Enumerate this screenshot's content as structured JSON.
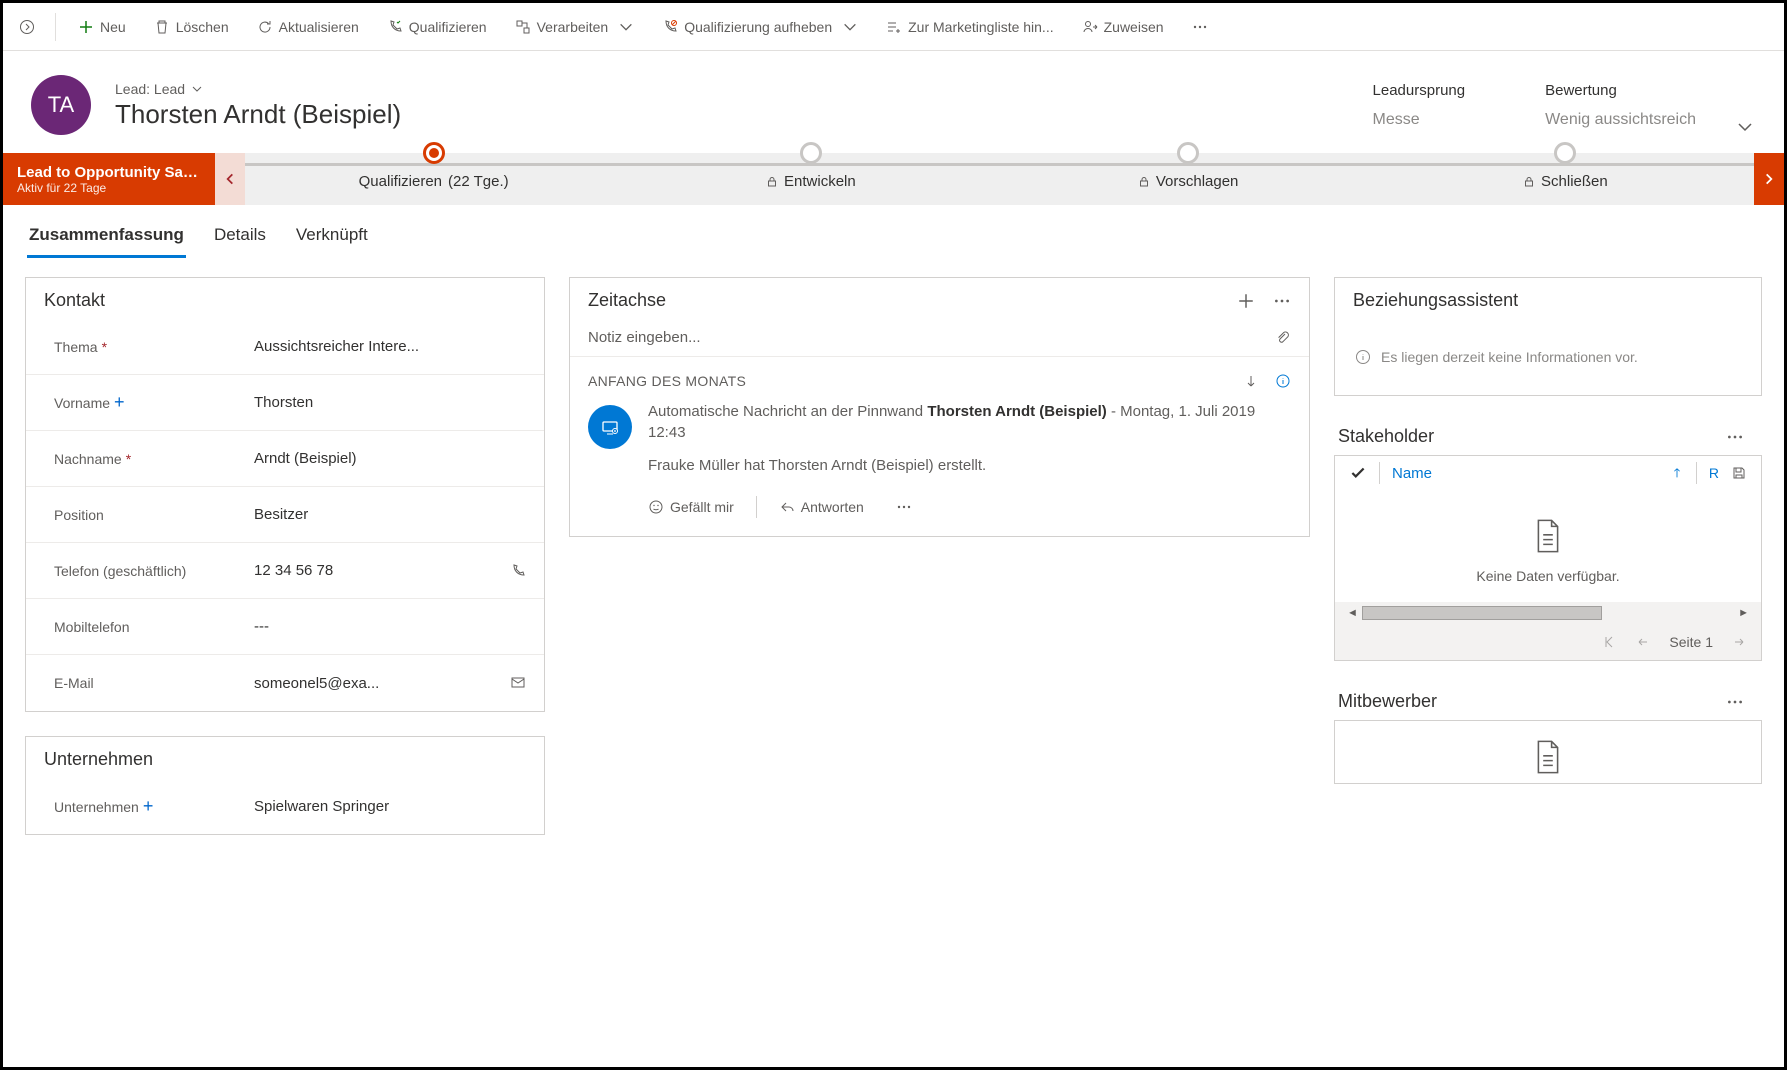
{
  "toolbar": {
    "new": "Neu",
    "delete": "Löschen",
    "refresh": "Aktualisieren",
    "qualify": "Qualifizieren",
    "process": "Verarbeiten",
    "disqualify": "Qualifizierung aufheben",
    "addmarketing": "Zur Marketingliste hin...",
    "assign": "Zuweisen"
  },
  "header": {
    "avatar_initials": "TA",
    "record_type": "Lead: Lead",
    "title": "Thorsten Arndt (Beispiel)",
    "fields": [
      {
        "label": "Leadursprung",
        "value": "Messe"
      },
      {
        "label": "Bewertung",
        "value": "Wenig aussichtsreich"
      }
    ]
  },
  "process": {
    "name": "Lead to Opportunity Sale...",
    "sub": "Aktiv für 22 Tage",
    "stages": [
      {
        "label": "Qualifizieren",
        "duration": "(22 Tge.)",
        "active": true,
        "locked": false
      },
      {
        "label": "Entwickeln",
        "locked": true
      },
      {
        "label": "Vorschlagen",
        "locked": true
      },
      {
        "label": "Schließen",
        "locked": true
      }
    ]
  },
  "tabs": [
    "Zusammenfassung",
    "Details",
    "Verknüpft"
  ],
  "contact": {
    "title": "Kontakt",
    "fields": {
      "thema": {
        "label": "Thema",
        "value": "Aussichtsreicher Intere..."
      },
      "vorname": {
        "label": "Vorname",
        "value": "Thorsten"
      },
      "nachname": {
        "label": "Nachname",
        "value": "Arndt (Beispiel)"
      },
      "position": {
        "label": "Position",
        "value": "Besitzer"
      },
      "telefon": {
        "label": "Telefon (geschäftlich)",
        "value": "12 34 56 78"
      },
      "mobil": {
        "label": "Mobiltelefon",
        "value": "---"
      },
      "email": {
        "label": "E-Mail",
        "value": "someonel5@exa..."
      }
    }
  },
  "company": {
    "title": "Unternehmen",
    "fields": {
      "unternehmen": {
        "label": "Unternehmen",
        "value": "Spielwaren Springer"
      }
    }
  },
  "timeline": {
    "title": "Zeitachse",
    "note_placeholder": "Notiz eingeben...",
    "section": "ANFANG DES MONATS",
    "item": {
      "prefix": "Automatische Nachricht an der Pinnwand ",
      "bold": "Thorsten Arndt (Beispiel)",
      "suffix": " -  Montag, 1. Juli 2019 12:43",
      "desc": "Frauke Müller hat Thorsten Arndt (Beispiel) erstellt.",
      "like": "Gefällt mir",
      "reply": "Antworten"
    }
  },
  "assistant": {
    "title": "Beziehungsassistent",
    "empty": "Es liegen derzeit keine Informationen vor."
  },
  "stakeholder": {
    "title": "Stakeholder",
    "col_name": "Name",
    "empty": "Keine Daten verfügbar.",
    "page": "Seite 1"
  },
  "competitors": {
    "title": "Mitbewerber"
  }
}
